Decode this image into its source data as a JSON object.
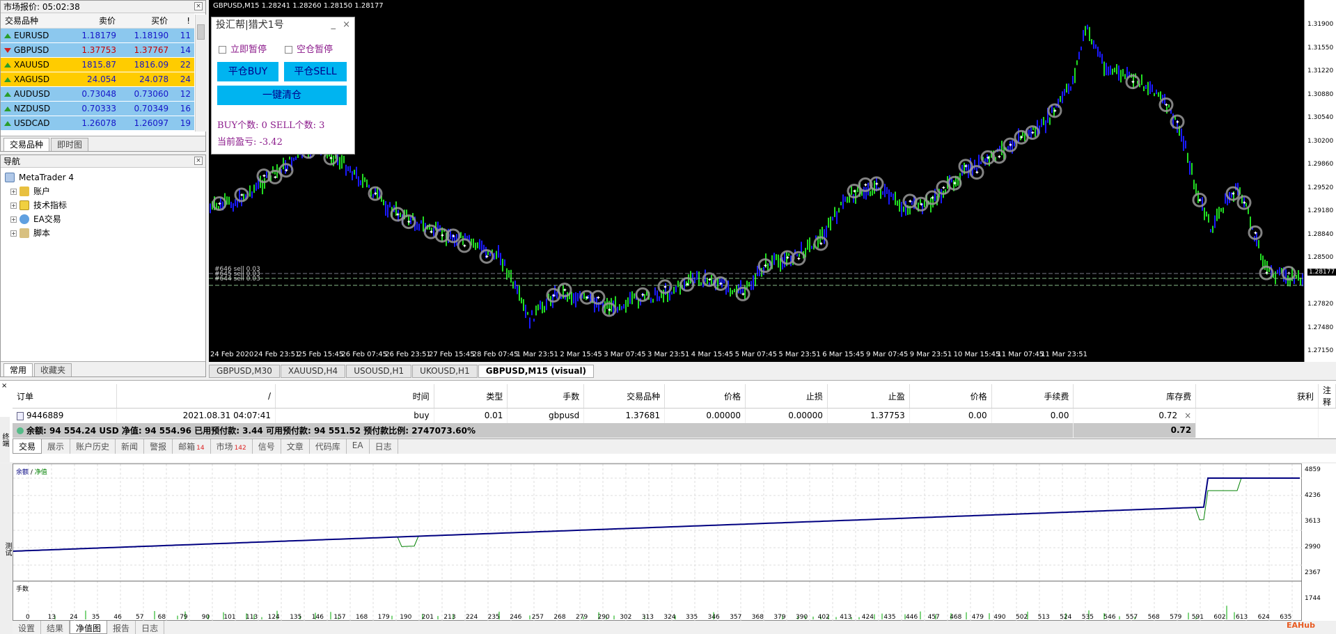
{
  "market_watch": {
    "title": "市场报价: 05:02:38",
    "headers": [
      "交易品种",
      "卖价",
      "买价",
      "!"
    ],
    "rows": [
      {
        "symbol": "EURUSD",
        "bid": "1.18179",
        "ask": "1.18190",
        "spread": "11",
        "dir": "up",
        "style": "blue"
      },
      {
        "symbol": "GBPUSD",
        "bid": "1.37753",
        "ask": "1.37767",
        "spread": "14",
        "dir": "down",
        "style": "blue"
      },
      {
        "symbol": "XAUUSD",
        "bid": "1815.87",
        "ask": "1816.09",
        "spread": "22",
        "dir": "up",
        "style": "gold"
      },
      {
        "symbol": "XAGUSD",
        "bid": "24.054",
        "ask": "24.078",
        "spread": "24",
        "dir": "up",
        "style": "gold"
      },
      {
        "symbol": "AUDUSD",
        "bid": "0.73048",
        "ask": "0.73060",
        "spread": "12",
        "dir": "up",
        "style": "blue"
      },
      {
        "symbol": "NZDUSD",
        "bid": "0.70333",
        "ask": "0.70349",
        "spread": "16",
        "dir": "up",
        "style": "blue"
      },
      {
        "symbol": "USDCAD",
        "bid": "1.26078",
        "ask": "1.26097",
        "spread": "19",
        "dir": "up",
        "style": "blue"
      }
    ],
    "tabs": [
      "交易品种",
      "即时图"
    ]
  },
  "navigator": {
    "title": "导航",
    "root": "MetaTrader 4",
    "items": [
      "账户",
      "技术指标",
      "EA交易",
      "脚本"
    ],
    "tabs": [
      "常用",
      "收藏夹"
    ]
  },
  "chart": {
    "header": "GBPUSD,M15  1.28241 1.28260 1.28150 1.28177",
    "price_labels": [
      "1.31900",
      "1.31550",
      "1.31220",
      "1.30880",
      "1.30540",
      "1.30200",
      "1.29860",
      "1.29520",
      "1.29180",
      "1.28840",
      "1.28500",
      "1.28177",
      "1.27820",
      "1.27480",
      "1.27150"
    ],
    "current_price": "1.28177",
    "time_labels": [
      "24 Feb 2020",
      "24 Feb 23:51",
      "25 Feb 15:45",
      "26 Feb 07:45",
      "26 Feb 23:51",
      "27 Feb 15:45",
      "28 Feb 07:45",
      "1 Mar 23:51",
      "2 Mar 15:45",
      "3 Mar 07:45",
      "3 Mar 23:51",
      "4 Mar 15:45",
      "5 Mar 07:45",
      "5 Mar 23:51",
      "6 Mar 15:45",
      "9 Mar 07:45",
      "9 Mar 23:51",
      "10 Mar 15:45",
      "11 Mar 07:45",
      "11 Mar 23:51"
    ],
    "order_labels": [
      "#646 sell 0.03",
      "#645 sell 0.03",
      "#644 sell 0.03"
    ],
    "accent_bull": "#22dd22",
    "accent_bear": "#1a1aff"
  },
  "chart_tabs": [
    "GBPUSD,M30",
    "XAUUSD,H4",
    "USOUSD,H1",
    "UKOUSD,H1",
    "GBPUSD,M15 (visual)"
  ],
  "ea_panel": {
    "title": "投汇帮|猎犬1号",
    "minimize": "_",
    "close": "×",
    "check1": "立即暂停",
    "check2": "空仓暂停",
    "btn_buy": "平仓BUY",
    "btn_sell": "平仓SELL",
    "btn_clear": "一键清仓",
    "counts": "BUY个数: 0   SELL个数: 3",
    "pnl": "当前盈亏: -3.42"
  },
  "terminal": {
    "headers": [
      "订单",
      "/",
      "时间",
      "类型",
      "手数",
      "交易品种",
      "价格",
      "止损",
      "止盈",
      "价格",
      "手续费",
      "库存费",
      "获利",
      "注释"
    ],
    "order": {
      "id": "9446889",
      "time": "2021.08.31 04:07:41",
      "type": "buy",
      "lots": "0.01",
      "symbol": "gbpusd",
      "price": "1.37681",
      "sl": "0.00000",
      "tp": "0.00000",
      "cur_price": "1.37753",
      "commission": "0.00",
      "swap": "0.00",
      "profit": "0.72"
    },
    "summary": "余额: 94 554.24 USD  净值: 94 554.96  已用预付款: 3.44  可用预付款: 94 551.52  预付款比例: 2747073.60%",
    "summary_profit": "0.72",
    "tabs": [
      {
        "label": "交易",
        "badge": ""
      },
      {
        "label": "展示",
        "badge": ""
      },
      {
        "label": "账户历史",
        "badge": ""
      },
      {
        "label": "新闻",
        "badge": ""
      },
      {
        "label": "警报",
        "badge": ""
      },
      {
        "label": "邮箱",
        "badge": "14"
      },
      {
        "label": "市场",
        "badge": "142"
      },
      {
        "label": "信号",
        "badge": ""
      },
      {
        "label": "文章",
        "badge": ""
      },
      {
        "label": "代码库",
        "badge": ""
      },
      {
        "label": "EA",
        "badge": ""
      },
      {
        "label": "日志",
        "badge": ""
      }
    ],
    "side_label": "终端"
  },
  "tester": {
    "legend_balance": "余额",
    "legend_equity": "净值",
    "volume_label": "手数",
    "y_labels": [
      "4859",
      "4236",
      "3613",
      "2990",
      "2367",
      "1744"
    ],
    "x_labels": [
      "0",
      "13",
      "24",
      "35",
      "46",
      "57",
      "68",
      "79",
      "90",
      "101",
      "113",
      "124",
      "135",
      "146",
      "157",
      "168",
      "179",
      "190",
      "201",
      "213",
      "224",
      "235",
      "246",
      "257",
      "268",
      "279",
      "290",
      "302",
      "313",
      "324",
      "335",
      "346",
      "357",
      "368",
      "379",
      "390",
      "402",
      "413",
      "424",
      "435",
      "446",
      "457",
      "468",
      "479",
      "490",
      "502",
      "513",
      "524",
      "535",
      "546",
      "557",
      "568",
      "579",
      "591",
      "602",
      "613",
      "624",
      "635"
    ],
    "tabs": [
      "设置",
      "结果",
      "净值图",
      "报告",
      "日志"
    ],
    "side_label": "测试",
    "watermark": "EAHub",
    "balance_color": "#000080",
    "equity_color": "#008000"
  }
}
